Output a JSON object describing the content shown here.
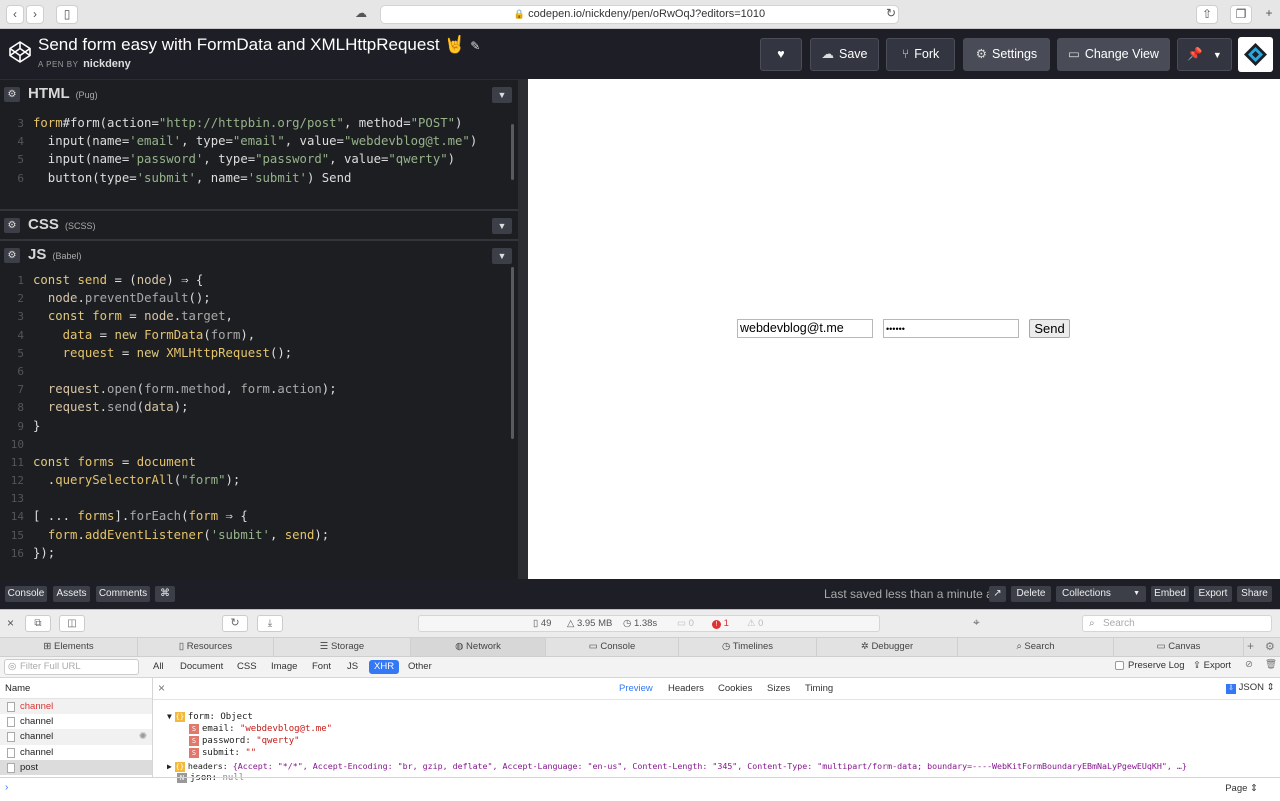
{
  "browser": {
    "url": "codepen.io/nickdeny/pen/oRwOqJ?editors=1010"
  },
  "header": {
    "title": "Send form easy with FormData and XMLHttpRequest",
    "title_emoji": "🤘",
    "by_prefix": "A PEN BY",
    "author": "nickdeny",
    "save": "Save",
    "fork": "Fork",
    "settings": "Settings",
    "change_view": "Change View"
  },
  "editors": {
    "html": {
      "name": "HTML",
      "lang": "(Pug)"
    },
    "css": {
      "name": "CSS",
      "lang": "(SCSS)"
    },
    "js": {
      "name": "JS",
      "lang": "(Babel)"
    }
  },
  "preview": {
    "email_value": "webdevblog@t.me",
    "password_mask": "••••••",
    "send_label": "Send"
  },
  "footer": {
    "console": "Console",
    "assets": "Assets",
    "comments": "Comments",
    "shortcut": "⌘",
    "saved_status": "Last saved less than a minute ago",
    "delete": "Delete",
    "collections": "Collections",
    "embed": "Embed",
    "export": "Export",
    "share": "Share"
  },
  "inspector": {
    "stats": {
      "resources": "49",
      "size": "3.95 MB",
      "time": "1.38s",
      "messages": "0",
      "errors": "1",
      "warnings": "0"
    },
    "search_placeholder": "Search",
    "tabs": [
      "Elements",
      "Resources",
      "Storage",
      "Network",
      "Console",
      "Timelines",
      "Debugger",
      "Search",
      "Canvas"
    ],
    "selected_tab": "Network",
    "filter_placeholder": "Filter Full URL",
    "filters": [
      "All",
      "Document",
      "CSS",
      "Image",
      "Font",
      "JS",
      "XHR",
      "Other"
    ],
    "selected_filter": "XHR",
    "preserve_log": "Preserve Log",
    "export": "Export",
    "list_header": "Name",
    "requests": [
      "channel",
      "channel",
      "channel",
      "channel",
      "post"
    ],
    "detail_tabs": [
      "Preview",
      "Headers",
      "Cookies",
      "Sizes",
      "Timing"
    ],
    "selected_detail": "Preview",
    "format": "JSON",
    "tree": {
      "form_key": "form:",
      "form_type": "Object",
      "email_key": "email:",
      "email_val": "\"webdevblog@t.me\"",
      "password_key": "password:",
      "password_val": "\"qwerty\"",
      "submit_key": "submit:",
      "submit_val": "\"\"",
      "headers_key": "headers:",
      "headers_val": "{Accept: \"*/*\", Accept-Encoding: \"br, gzip, deflate\", Accept-Language: \"en-us\", Content-Length: \"345\", Content-Type: \"multipart/form-data; boundary=----WebKitFormBoundaryEBmNaLyPgewEUqKH\", …}",
      "json_key": "json:",
      "json_val": "null"
    },
    "console_scope": "Page"
  }
}
